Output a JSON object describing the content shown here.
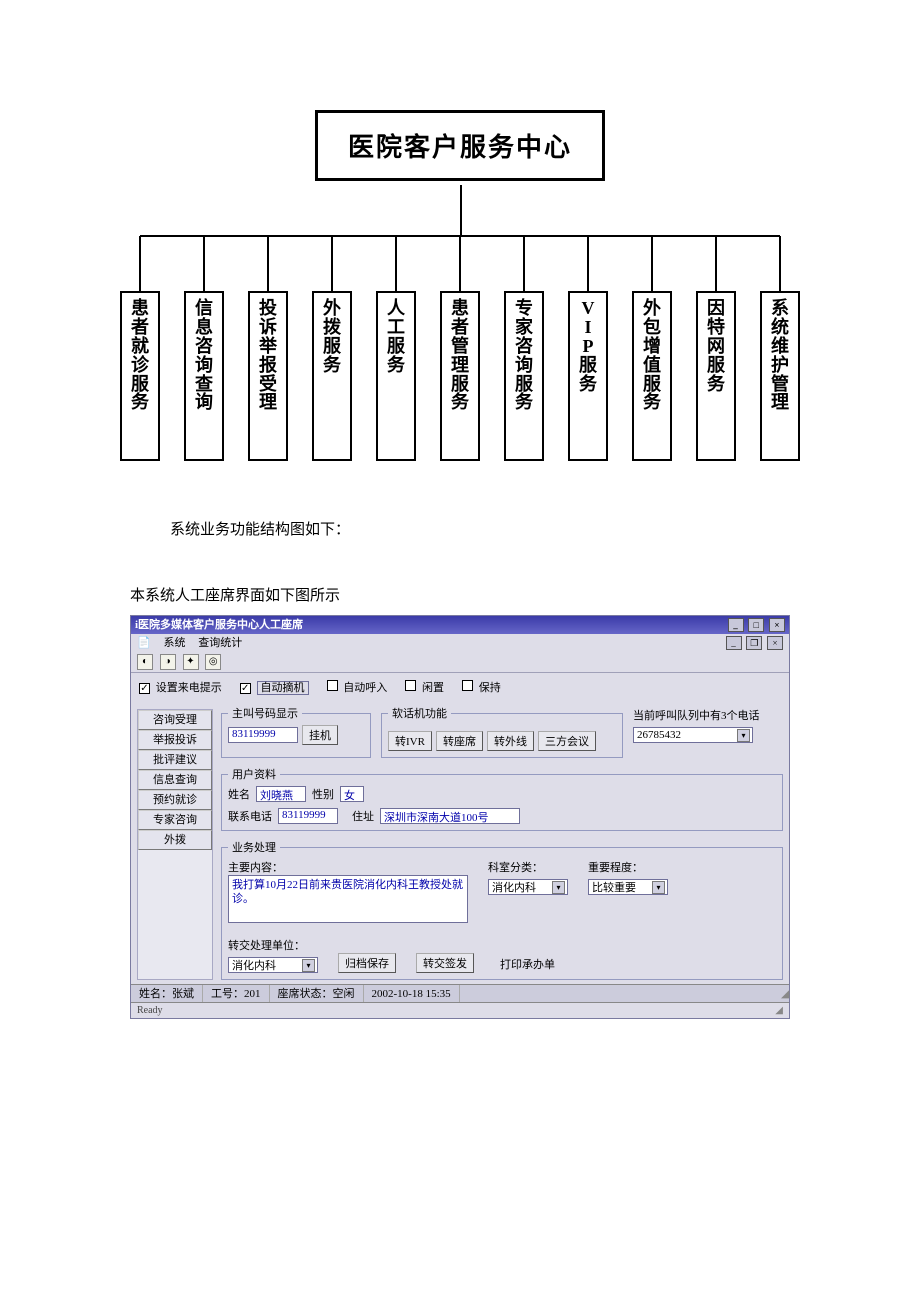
{
  "chart_data": {
    "type": "org-chart",
    "root": "医院客户服务中心",
    "children": [
      {
        "label": "患者就诊服务"
      },
      {
        "label": "信息咨询查询"
      },
      {
        "label": "投诉举报受理"
      },
      {
        "label": "外拨服务"
      },
      {
        "label": "人工服务"
      },
      {
        "label": "患者管理服务"
      },
      {
        "label": "专家咨询服务"
      },
      {
        "label": "VIP服务"
      },
      {
        "label": "外包增值服务"
      },
      {
        "label": "因特网服务"
      },
      {
        "label": "系统维护管理"
      }
    ]
  },
  "caption1": "系统业务功能结构图如下：",
  "caption2": "本系统人工座席界面如下图所示",
  "win": {
    "title": "i医院多媒体客户服务中心人工座席",
    "menu": {
      "items": [
        "系统",
        "查询统计"
      ]
    },
    "options": {
      "opt1": {
        "label": "设置来电提示",
        "checked": true
      },
      "opt2": {
        "label": "自动摘机",
        "checked": true,
        "boxed": true
      },
      "opt3": {
        "label": "自动呼入",
        "checked": false
      },
      "opt4": {
        "label": "闲置",
        "checked": false
      },
      "opt5": {
        "label": "保持",
        "checked": false
      }
    },
    "side": [
      "咨询受理",
      "举报投诉",
      "批评建议",
      "信息查询",
      "预约就诊",
      "专家咨询",
      "外拨"
    ],
    "caller": {
      "legend": "主叫号码显示",
      "number": "83119999",
      "hangup": "挂机"
    },
    "softphone": {
      "legend": "软话机功能",
      "buttons": [
        "转IVR",
        "转座席",
        "转外线",
        "三方会议"
      ]
    },
    "queue": {
      "label": "当前呼叫队列中有3个电话",
      "value": "26785432"
    },
    "userinfo": {
      "legend": "用户资料",
      "name_lbl": "姓名",
      "name": "刘晓燕",
      "sex_lbl": "性别",
      "sex": "女",
      "phone_lbl": "联系电话",
      "phone": "83119999",
      "addr_lbl": "住址",
      "addr": "深圳市深南大道100号"
    },
    "biz": {
      "legend": "业务处理",
      "content_lbl": "主要内容：",
      "content": "我打算10月22日前来贵医院消化内科王教授处就诊。",
      "dept_lbl": "科室分类：",
      "dept": "消化内科",
      "prio_lbl": "重要程度：",
      "prio": "比较重要",
      "tounit_lbl": "转交处理单位：",
      "tounit": "消化内科",
      "save": "归档保存",
      "send": "转交签发",
      "print": "打印承办单"
    },
    "status": {
      "name_lbl": "姓名：",
      "name": "张斌",
      "id_lbl": "工号：",
      "id": "201",
      "state_lbl": "座席状态：",
      "state": "空闲",
      "time": "2002-10-18 15:35"
    },
    "ready": "Ready"
  }
}
